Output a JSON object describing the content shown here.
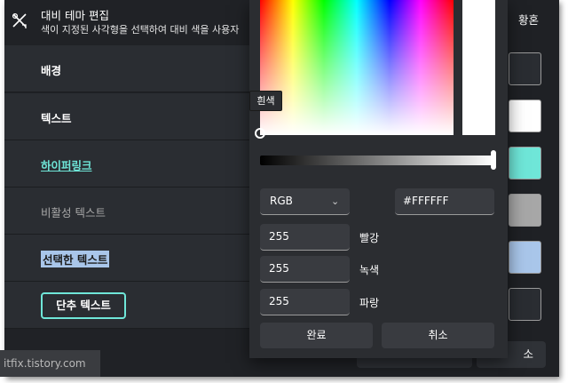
{
  "header": {
    "icon": "palette-edit-icon",
    "title": "대비 테마 편집",
    "subtitle": "색이 지정된 사각형을 선택하여 대비 색을 사용자"
  },
  "rows": {
    "background": "배경",
    "text": "텍스트",
    "hyperlink": "하이퍼링크",
    "disabled_text": "비활성 텍스트",
    "selected_text": "선택한 텍스트",
    "button_text": "단추 텍스트"
  },
  "right": {
    "header": "황혼",
    "bottom_button": "소",
    "swatches": [
      "#2a2d32",
      "#ffffff",
      "#6fe6d8",
      "#a7a7a7",
      "#a9c6ea",
      "#2a2d32"
    ]
  },
  "picker": {
    "tooltip": "흰색",
    "mode": "RGB",
    "hex": "#FFFFFF",
    "red_label": "빨강",
    "red": "255",
    "green_label": "녹색",
    "green": "255",
    "blue_label": "파랑",
    "blue": "255",
    "done": "완료",
    "cancel": "취소",
    "selected_color": "#FFFFFF"
  },
  "watermark": "itfix.tistory.com"
}
